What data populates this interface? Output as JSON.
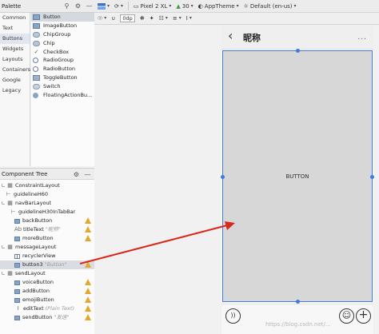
{
  "palette": {
    "title": "Palette",
    "categories": [
      "Common",
      "Text",
      "Buttons",
      "Widgets",
      "Layouts",
      "Containers",
      "Google",
      "Legacy"
    ],
    "selected_category": "Buttons",
    "widgets": [
      "Button",
      "ImageButton",
      "ChipGroup",
      "Chip",
      "CheckBox",
      "RadioGroup",
      "RadioButton",
      "ToggleButton",
      "Switch",
      "FloatingActionBu..."
    ]
  },
  "component_tree": {
    "title": "Component Tree",
    "items": [
      {
        "label": "ConstraintLayout"
      },
      {
        "label": "guidelineH60"
      },
      {
        "label": "navBarLayout"
      },
      {
        "label": "guidelineH30InTabBar"
      },
      {
        "label": "backButton"
      },
      {
        "label": "titleText",
        "hint": "\"昵称\""
      },
      {
        "label": "moreButton"
      },
      {
        "label": "messageLayout"
      },
      {
        "label": "recyclerView"
      },
      {
        "label": "button3",
        "hint": "\"Button\""
      },
      {
        "label": "sendLayout"
      },
      {
        "label": "voiceButton"
      },
      {
        "label": "addButton"
      },
      {
        "label": "emojiButton"
      },
      {
        "label": "editText",
        "hint": "(Plain Text)"
      },
      {
        "label": "sendButton",
        "hint": "\"发送\""
      }
    ]
  },
  "toolbar": {
    "device": "Pixel 2 XL",
    "api": "30",
    "theme": "AppTheme",
    "locale": "Default (en-us)",
    "margin": "0dp"
  },
  "preview": {
    "title": "昵称",
    "button_label": "BUTTON",
    "more": "...",
    "back": "‹"
  },
  "watermark": "https://blog.csdn.net/..."
}
